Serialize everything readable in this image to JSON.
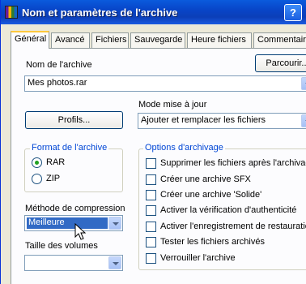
{
  "window": {
    "title": "Nom et paramètres de l'archive",
    "help": "?"
  },
  "tabs": [
    "Général",
    "Avancé",
    "Fichiers",
    "Sauvegarde",
    "Heure fichiers",
    "Commentaire"
  ],
  "archive_name": {
    "label": "Nom de l'archive",
    "value": "Mes photos.rar",
    "browse_label": "Parcourir..."
  },
  "profiles_label": "Profils...",
  "update_mode": {
    "label": "Mode mise à jour",
    "value": "Ajouter et remplacer les fichiers"
  },
  "archive_format": {
    "title": "Format de l'archive",
    "options": [
      "RAR",
      "ZIP"
    ],
    "selected": "RAR"
  },
  "compression": {
    "label": "Méthode de compression",
    "value": "Meilleure"
  },
  "volume_size": {
    "label": "Taille des volumes",
    "value": ""
  },
  "options": {
    "title": "Options d'archivage",
    "items": [
      "Supprimer les fichiers après l'archivage",
      "Créer une archive SFX",
      "Créer une archive 'Solide'",
      "Activer la vérification d'authenticité",
      "Activer l'enregistrement de restauration",
      "Tester les fichiers archivés",
      "Verrouiller l'archive"
    ]
  },
  "colors": {
    "titlebar": "#0845c8",
    "selection": "#316ac5",
    "group_title": "#0046d5",
    "radio_dot": "#21a121"
  }
}
